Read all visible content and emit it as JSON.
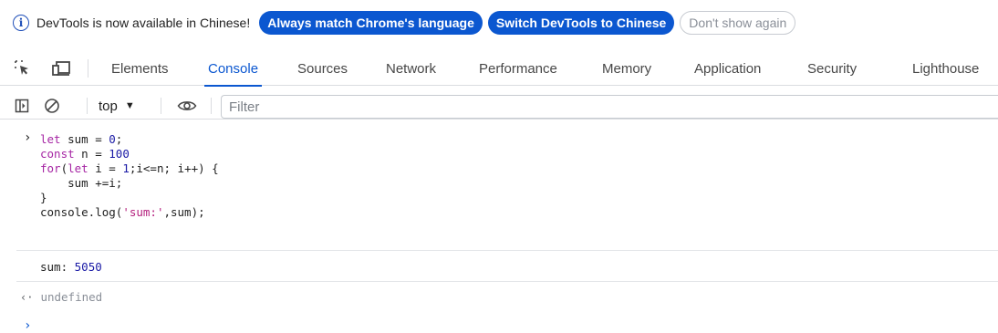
{
  "infobar": {
    "message": "DevTools is now available in Chinese!",
    "always_match": "Always match Chrome's language",
    "switch": "Switch DevTools to Chinese",
    "dont_show": "Don't show again"
  },
  "tabs": [
    {
      "label": "Elements"
    },
    {
      "label": "Console"
    },
    {
      "label": "Sources"
    },
    {
      "label": "Network"
    },
    {
      "label": "Performance"
    },
    {
      "label": "Memory"
    },
    {
      "label": "Application"
    },
    {
      "label": "Security"
    },
    {
      "label": "Lighthouse"
    }
  ],
  "active_tab": "Console",
  "toolbar": {
    "context": "top",
    "filter_placeholder": "Filter"
  },
  "console": {
    "input_lines": [
      "let sum = 0;",
      "const n = 100",
      "for(let i = 1;i<=n; i++) {",
      "    sum +=i;",
      "}",
      "console.log('sum:',sum);"
    ],
    "output_label": "sum:",
    "output_value": "5050",
    "result": "undefined"
  },
  "colors": {
    "accent": "#0b57d0",
    "keyword": "#a626a4",
    "number": "#1a1aa6",
    "string": "#b4207d"
  }
}
